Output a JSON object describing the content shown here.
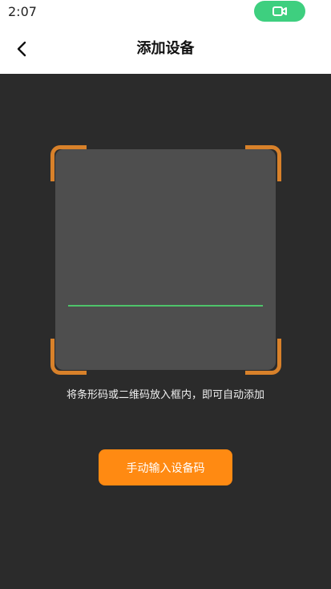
{
  "status_bar": {
    "time": "2:07"
  },
  "header": {
    "title": "添加设备"
  },
  "scanner": {
    "hint": "将条形码或二维码放入框内，即可自动添加"
  },
  "actions": {
    "manual_input_label": "手动输入设备码"
  },
  "colors": {
    "accent_orange": "#ff8a12",
    "corner_orange": "#d8812a",
    "scan_line_green": "#4ec46a",
    "recording_green": "#3ecf7f"
  }
}
